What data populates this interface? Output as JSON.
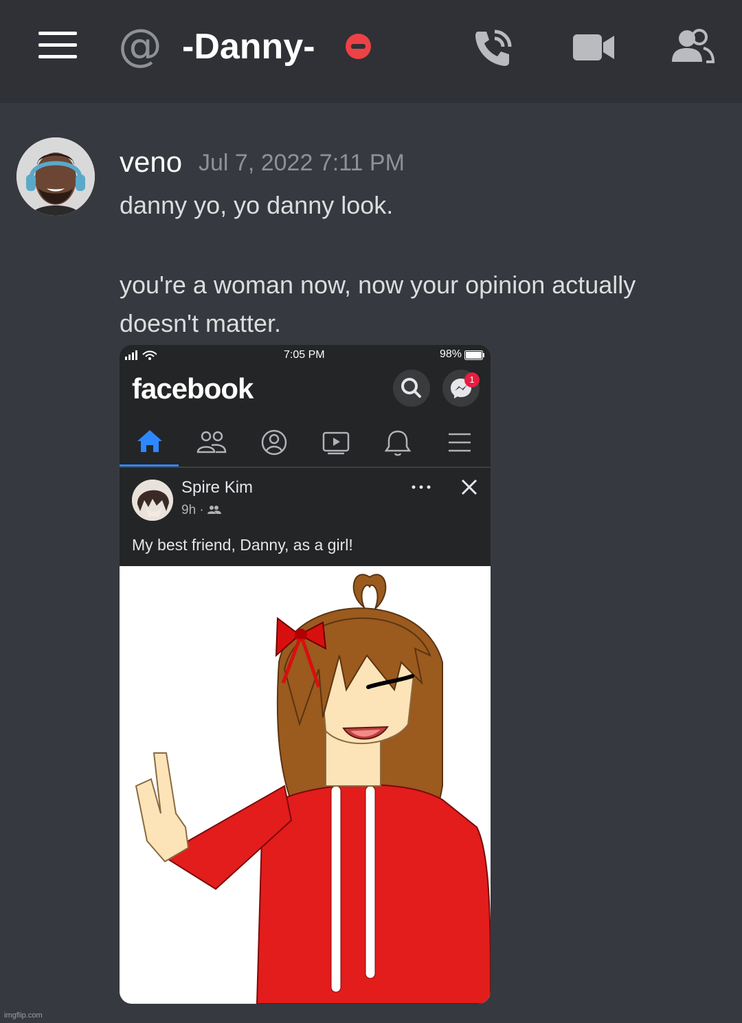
{
  "header": {
    "at_symbol": "@",
    "title": "-Danny-",
    "icons": [
      "hamburger-menu-icon",
      "at-icon",
      "do-not-disturb-status-icon",
      "call-icon",
      "video-call-icon",
      "members-icon"
    ]
  },
  "message": {
    "author": "veno",
    "timestamp": "Jul 7, 2022 7:11 PM",
    "lines": [
      "danny yo, yo danny look.",
      "you're a woman now, now your opinion actually",
      "doesn't matter."
    ]
  },
  "embed": {
    "status_time": "7:05 PM",
    "battery": "98%",
    "app_name": "facebook",
    "messenger_badge": "1",
    "post": {
      "author": "Spire Kim",
      "time": "9h ·",
      "text": "My best friend, Danny, as a girl!"
    }
  },
  "watermark": "imgflip.com",
  "colors": {
    "background": "#36393f",
    "header": "#2f3136",
    "dnd_red": "#ed4245",
    "fb_blue": "#2d88ff"
  }
}
